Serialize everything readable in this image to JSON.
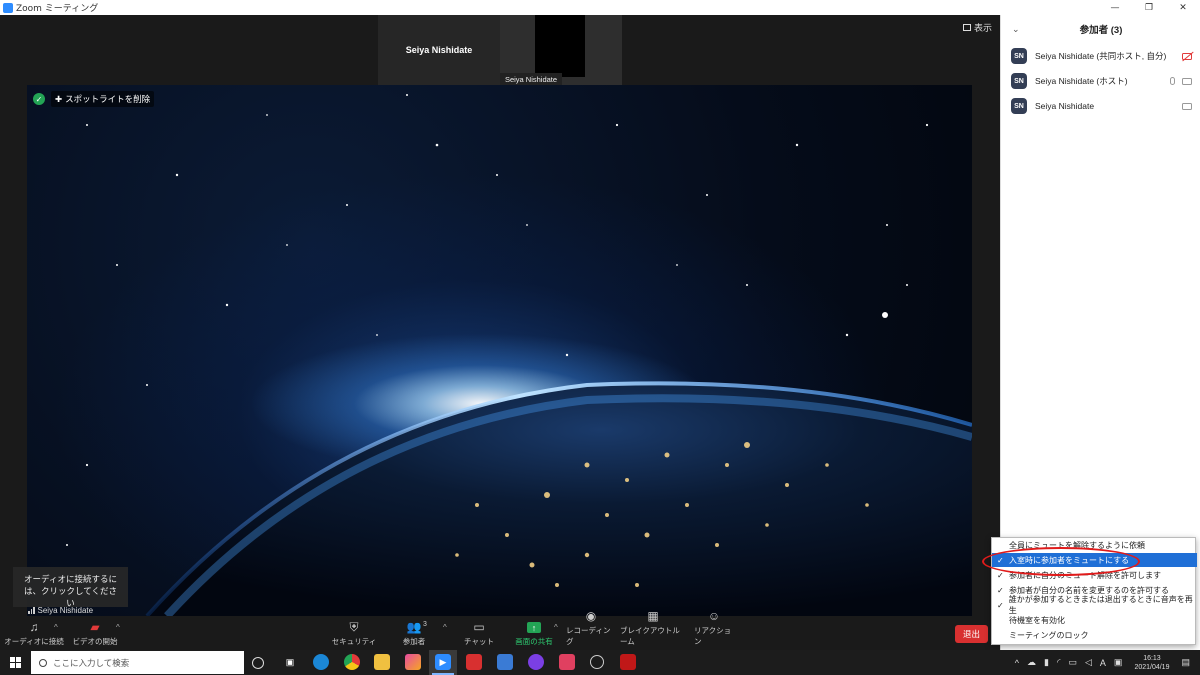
{
  "window": {
    "title": "Zoom ミーティング",
    "minimize": "—",
    "maximize": "❐",
    "close": "✕"
  },
  "thumbnails": {
    "name_tile": "Seiya Nishidate",
    "video_label": "Seiya Nishidate",
    "view_label": "表示"
  },
  "main_video": {
    "spotlight_remove": "スポットライトを削除"
  },
  "audio_tooltip": {
    "text": "オーディオに接続するには、クリックしてください"
  },
  "self_name": "Seiya Nishidate",
  "toolbar": {
    "audio": "オーディオに接続",
    "video": "ビデオの開始",
    "security": "セキュリティ",
    "participants": "参加者",
    "participants_count": "3",
    "chat": "チャット",
    "share": "画面の共有",
    "record": "レコーディング",
    "breakout": "ブレイクアウトルーム",
    "reactions": "リアクション",
    "leave": "退出"
  },
  "participants_panel": {
    "title": "参加者 (3)",
    "items": [
      {
        "initials": "SN",
        "name": "Seiya Nishidate (共同ホスト, 自分)",
        "mic": false,
        "cam": "off"
      },
      {
        "initials": "SN",
        "name": "Seiya Nishidate (ホスト)",
        "mic": true,
        "cam": "on"
      },
      {
        "initials": "SN",
        "name": "Seiya Nishidate",
        "mic": false,
        "cam": "on"
      }
    ]
  },
  "more_menu": {
    "items": [
      {
        "label": "全員にミュートを解除するように依頼",
        "checked": false,
        "selected": false
      },
      {
        "label": "入室時に参加者をミュートにする",
        "checked": true,
        "selected": true
      },
      {
        "label": "参加者に自分のミュート解除を許可します",
        "checked": true,
        "selected": false
      },
      {
        "label": "参加者が自分の名前を変更するのを許可する",
        "checked": true,
        "selected": false
      },
      {
        "label": "誰かが参加するときまたは退出するときに音声を再生",
        "checked": true,
        "selected": false
      },
      {
        "label": "待機室を有効化",
        "checked": false,
        "selected": false
      },
      {
        "label": "ミーティングのロック",
        "checked": false,
        "selected": false
      }
    ]
  },
  "taskbar": {
    "search_placeholder": "ここに入力して検索",
    "ime": "A",
    "time": "16:13",
    "date": "2021/04/19"
  },
  "colors": {
    "zoom_blue": "#2d8cff",
    "share_green": "#23a455",
    "leave_red": "#d83030",
    "menu_select": "#1f6fd6",
    "highlight_ellipse": "#e01b1b"
  }
}
